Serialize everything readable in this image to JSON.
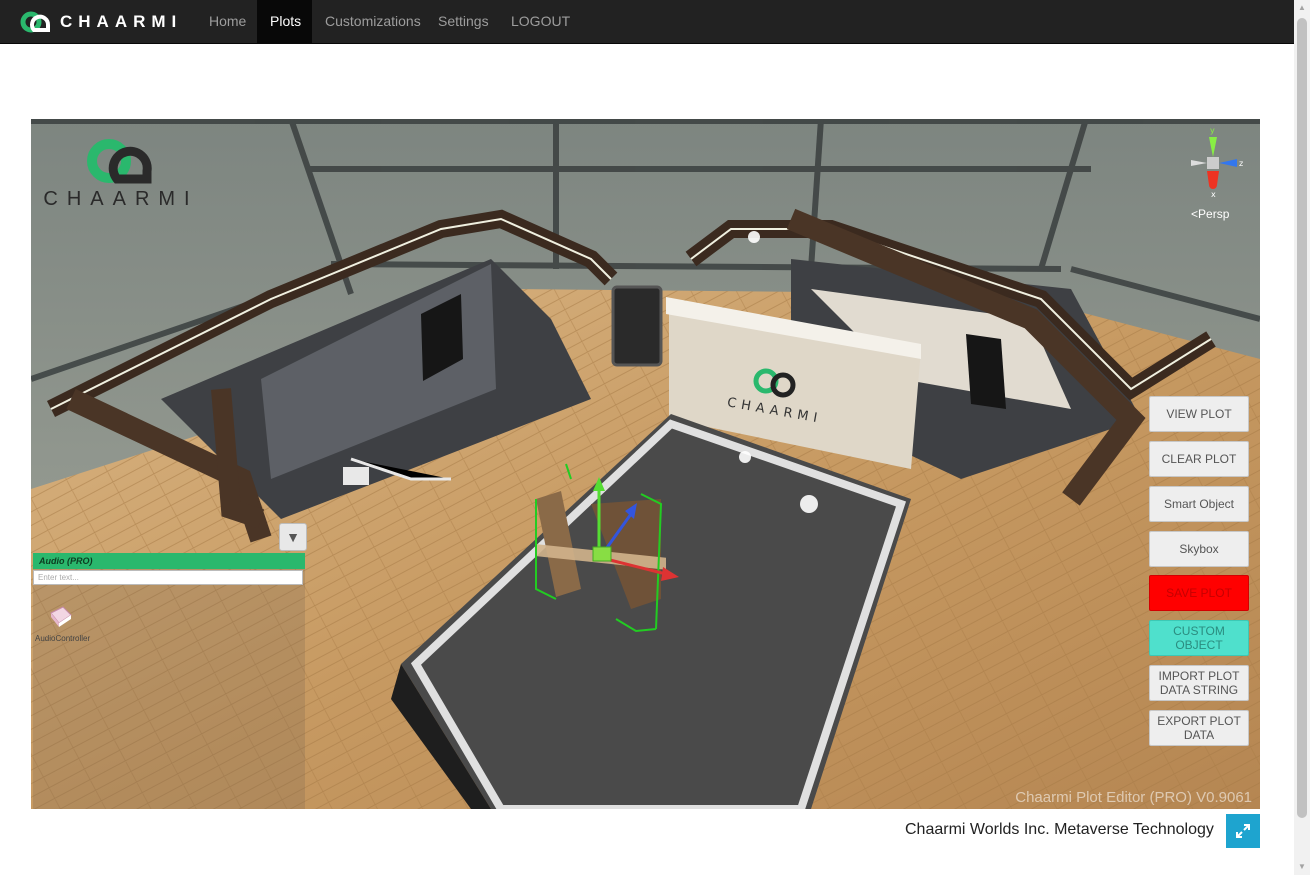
{
  "navbar": {
    "brand": "CHAARMI",
    "links": [
      {
        "label": "Home",
        "active": false
      },
      {
        "label": "Plots",
        "active": true
      },
      {
        "label": "Customizations",
        "active": false
      },
      {
        "label": "Settings",
        "active": false
      },
      {
        "label": "LOGOUT",
        "active": false
      }
    ]
  },
  "viewport": {
    "logo_text": "CHAARMI",
    "screen_logo_text": "CHAARMI",
    "gizmo": {
      "y": "y",
      "z": "z",
      "x": "x",
      "mode": "Persp"
    },
    "watermark": "Chaarmi Plot Editor (PRO) V0.9061",
    "buttons": {
      "view_plot": "VIEW PLOT",
      "clear_plot": "CLEAR PLOT",
      "smart_object": "Smart Object",
      "skybox": "Skybox",
      "save_plot": "SAVE PLOT",
      "custom_object": "CUSTOM OBJECT",
      "import_plot": "IMPORT PLOT DATA STRING",
      "export_plot": "EXPORT PLOT DATA"
    },
    "audio_panel": {
      "title": "Audio (PRO)",
      "search_placeholder": "Enter text...",
      "item_label": "AudioController"
    },
    "colors": {
      "save": "#ff0000",
      "custom": "#4fe0cc",
      "panel_header": "#2ab86d"
    }
  },
  "footer": {
    "company": "Chaarmi Worlds Inc. Metaverse Technology"
  }
}
